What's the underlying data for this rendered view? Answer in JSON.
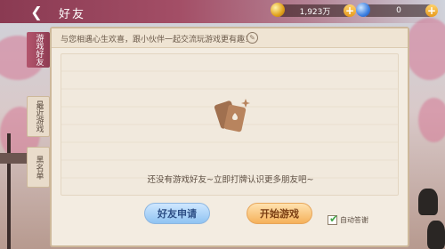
{
  "header": {
    "title": "好友"
  },
  "resources": {
    "gold_value": "1,923万",
    "gem_value": "0",
    "add_symbol": "+"
  },
  "tabs": [
    {
      "label": "游戏好友"
    },
    {
      "label": "最近游戏"
    },
    {
      "label": "黑名单"
    }
  ],
  "panel": {
    "banner_text": "与您相遇心生欢喜，跟小伙伴一起交流玩游戏更有趣！",
    "empty_text": "还没有游戏好友~立即打牌认识更多朋友吧~"
  },
  "buttons": {
    "friend_request": "好友申请",
    "start_game": "开始游戏"
  },
  "auto_reply": {
    "label": "自动答谢",
    "checked": true
  },
  "colors": {
    "accent": "#a34e66",
    "panel_bg": "#f3ece1",
    "request_btn": "#8fc3f2",
    "start_btn": "#f5b15a"
  }
}
